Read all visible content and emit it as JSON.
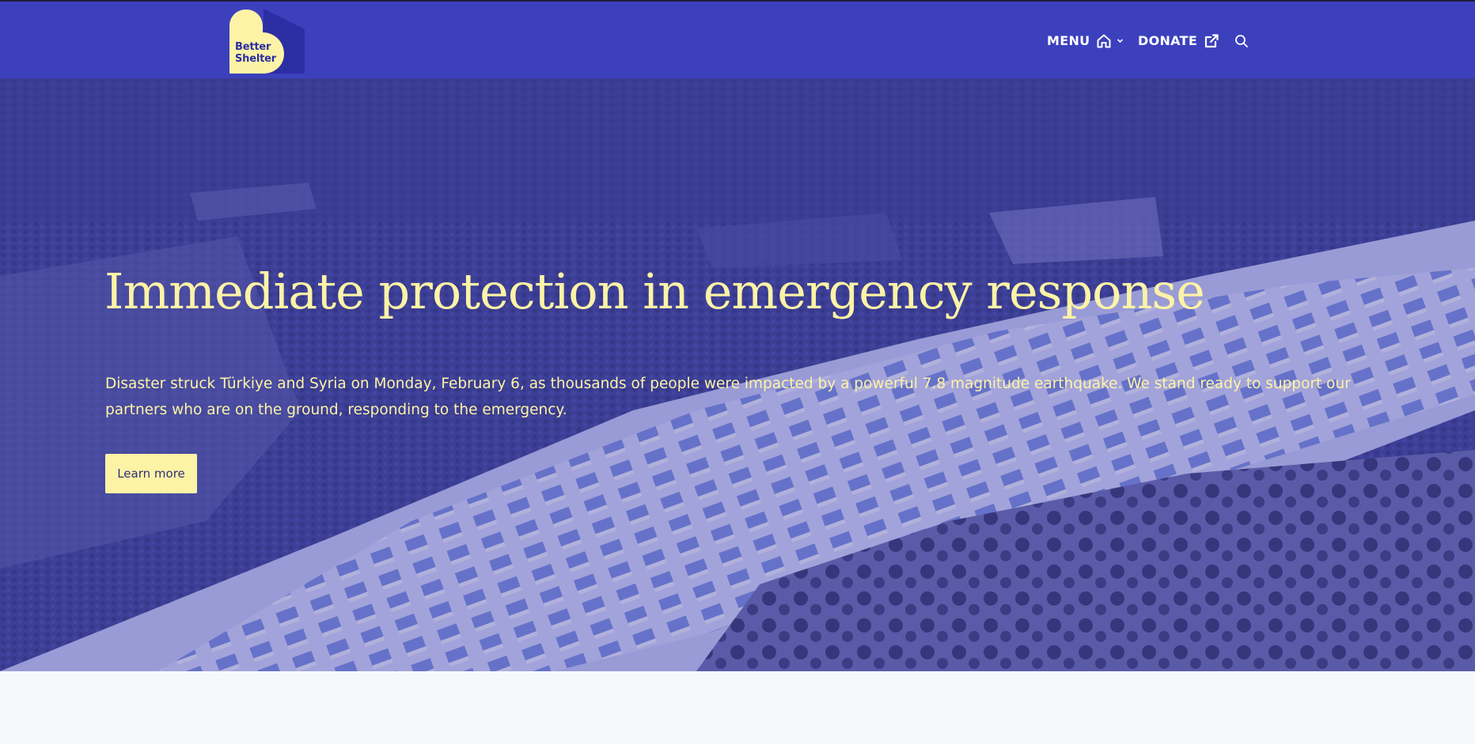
{
  "header": {
    "logo_text_line1": "Better",
    "logo_text_line2": "Shelter",
    "nav_menu_label": "MENU",
    "nav_donate_label": "DONATE",
    "icons": {
      "menu": "home-icon",
      "menu_chevron": "chevron-down-icon",
      "donate": "external-link-icon",
      "search": "search-icon"
    }
  },
  "hero": {
    "title": "Immediate protection in emergency response",
    "text": "Disaster struck Türkiye and Syria on Monday, February 6, as thousands of people were impacted by a powerful 7.8 magnitude earthquake. We stand ready to support our partners who are on the ground, responding to the emergency.",
    "button_label": "Learn more"
  },
  "colors": {
    "header_bg": "#3c40bd",
    "accent_yellow": "#fdf3a6",
    "logo_dark": "#2c2ea3",
    "page_bg": "#f7f8fb"
  }
}
